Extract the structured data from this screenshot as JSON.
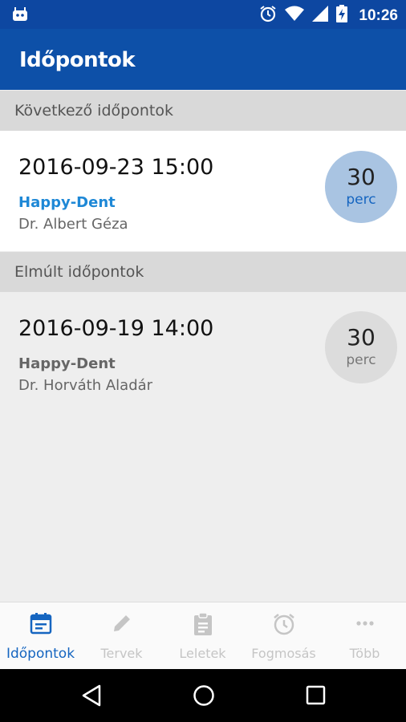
{
  "status_bar": {
    "time": "10:26",
    "icons": [
      "android-icon",
      "alarm-icon",
      "wifi-icon",
      "signal-icon",
      "battery-charging-icon"
    ]
  },
  "toolbar": {
    "title": "Időpontok"
  },
  "sections": {
    "upcoming": {
      "header": "Következő időpontok",
      "appointment": {
        "datetime": "2016-09-23 15:00",
        "clinic": "Happy-Dent",
        "doctor": "Dr. Albert Géza",
        "duration": "30",
        "duration_unit": "perc"
      }
    },
    "past": {
      "header": "Elmúlt időpontok",
      "appointment": {
        "datetime": "2016-09-19 14:00",
        "clinic": "Happy-Dent",
        "doctor": "Dr. Horváth Aladár",
        "duration": "30",
        "duration_unit": "perc"
      }
    }
  },
  "bottom_nav": {
    "items": [
      {
        "label": "Időpontok",
        "icon": "calendar-icon",
        "active": true
      },
      {
        "label": "Tervek",
        "icon": "pencil-icon",
        "active": false
      },
      {
        "label": "Leletek",
        "icon": "clipboard-icon",
        "active": false
      },
      {
        "label": "Fogmosás",
        "icon": "alarm-clock-icon",
        "active": false
      },
      {
        "label": "Több",
        "icon": "more-dots-icon",
        "active": false
      }
    ]
  },
  "colors": {
    "primary": "#0d50a8",
    "accent": "#1e88d6",
    "upcoming_badge_bg": "#a9c4e2",
    "past_badge_bg": "#dcdcdc",
    "inactive_nav": "#c5c5c5"
  }
}
